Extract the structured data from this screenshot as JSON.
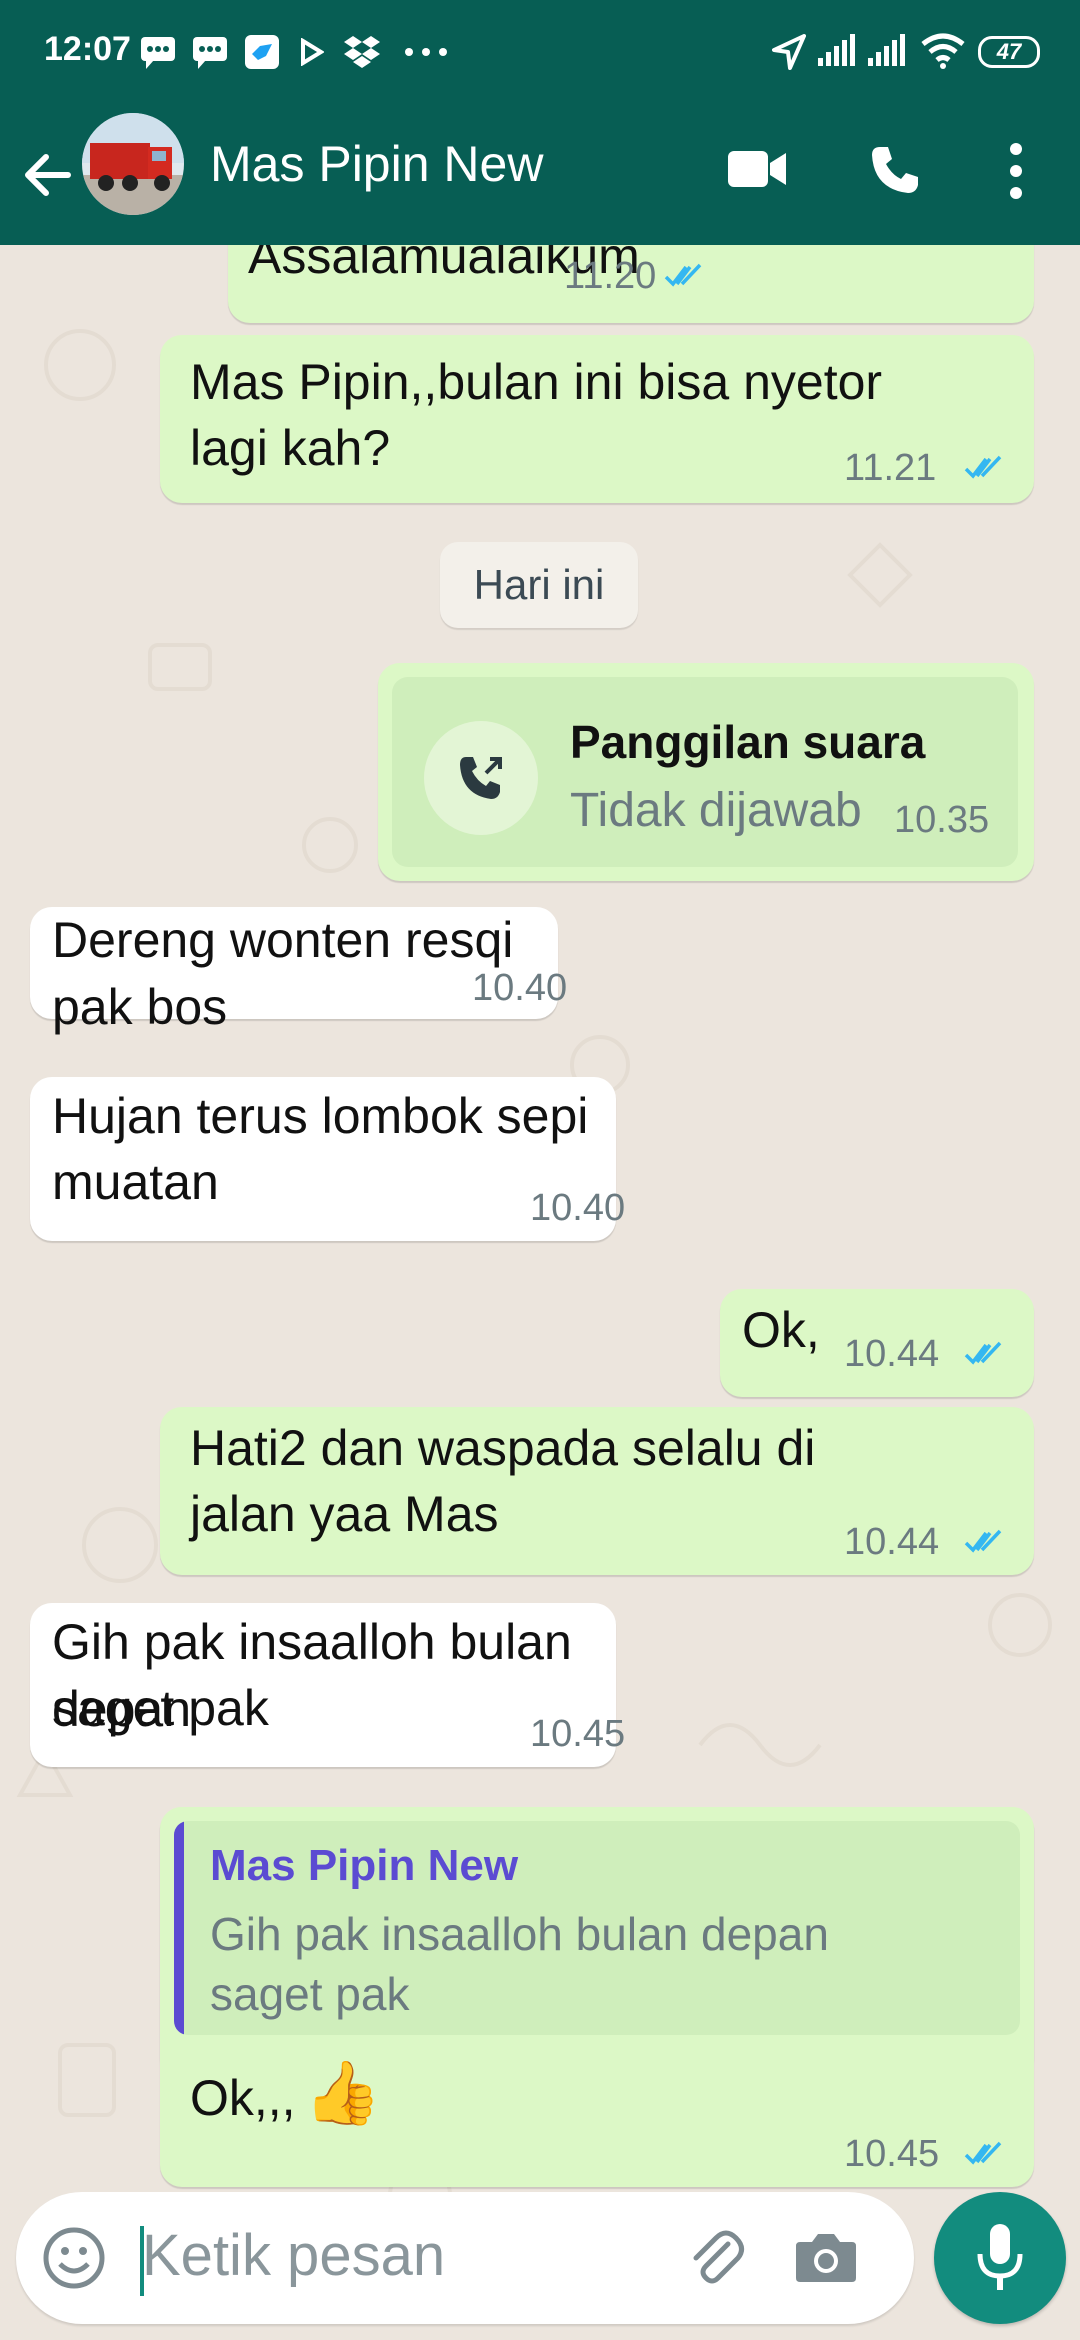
{
  "status_bar": {
    "time": "12:07",
    "battery": "47",
    "icons": [
      "message-icon",
      "message-icon",
      "app-icon",
      "play-icon",
      "dropbox-icon",
      "more-dots-icon",
      "location-icon",
      "signal-icon",
      "signal-icon",
      "wifi-icon",
      "battery-icon"
    ]
  },
  "header": {
    "contact_name": "Mas Pipin New",
    "icons": [
      "back-arrow-icon",
      "avatar",
      "video-call-icon",
      "phone-icon",
      "kebab-menu-icon"
    ]
  },
  "messages": {
    "m1": {
      "text": "Assalamualaikum",
      "time": "11.20",
      "direction": "out",
      "read": true
    },
    "m2": {
      "text_line1": "Mas Pipin,,bulan ini bisa nyetor",
      "text_line2": "lagi kah?",
      "time": "11.21",
      "direction": "out",
      "read": true
    },
    "date_chip": "Hari ini",
    "call": {
      "title": "Panggilan suara",
      "subtitle": "Tidak dijawab",
      "time": "10.35",
      "direction": "out"
    },
    "m3": {
      "text": "Dereng wonten resqi pak bos",
      "time": "10.40",
      "direction": "in"
    },
    "m4": {
      "text_line1": "Hujan terus lombok sepi",
      "text_line2": "muatan",
      "time": "10.40",
      "direction": "in"
    },
    "m5": {
      "text": "Ok,",
      "time": "10.44",
      "direction": "out",
      "read": true
    },
    "m6": {
      "text_line1": "Hati2 dan waspada selalu di",
      "text_line2": "jalan yaa Mas",
      "time": "10.44",
      "direction": "out",
      "read": true
    },
    "m7": {
      "text_line1": "Gih pak insaalloh bulan depan",
      "text_line2": "saget pak",
      "time": "10.45",
      "direction": "in"
    },
    "m8": {
      "quote_author": "Mas Pipin New",
      "quote_line1": "Gih pak insaalloh bulan depan",
      "quote_line2": "saget pak",
      "text": "Ok,,,",
      "emoji": "👍",
      "time": "10.45",
      "direction": "out",
      "read": true
    }
  },
  "input": {
    "placeholder": "Ketik pesan",
    "icons": [
      "emoji-icon",
      "attach-icon",
      "camera-icon",
      "mic-icon"
    ]
  },
  "colors": {
    "header": "#075e54",
    "outgoing_bubble": "#dcf8c6",
    "incoming_bubble": "#ffffff",
    "read_ticks": "#34b7f1",
    "quote_bar": "#5b4bd2",
    "mic_button": "#128c7e"
  }
}
